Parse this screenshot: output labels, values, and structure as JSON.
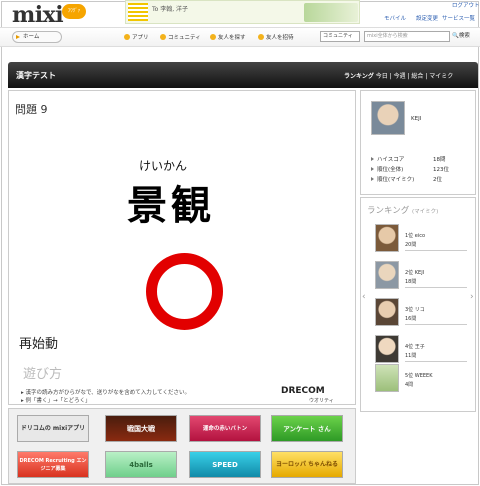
{
  "header": {
    "logo": "mixi",
    "logo_badge": "ﾌﾜｸﾞｧ",
    "banner_text": "To 李翰, 洋子",
    "top_links": {
      "logout": "ログアウト",
      "mobile": "モバイル",
      "settings": "設定変更",
      "service": "サービス一覧"
    },
    "nav": {
      "home": "ホーム",
      "app": "アプリ",
      "community": "コミュニティ",
      "find_friends": "友人を探す",
      "invite": "友人を招待"
    },
    "search": {
      "scope": "コミュニティ",
      "placeholder": "mixi全体から検索",
      "button": "検索"
    }
  },
  "titlebar": {
    "title": "漢字テスト",
    "ranking_label": "ランキング",
    "ranking_tabs": "今日 | 今週 | 総合 | マイミク"
  },
  "question": {
    "label": "問題 9",
    "reading": "けいかん",
    "kanji": "景観",
    "mark": "correct"
  },
  "restart": "再始動",
  "howto": "遊び方",
  "instructions": [
    "漢字の読み方がひらがなで、送りがなを含めて入力してください。",
    "例「書く」→「とどろく」"
  ],
  "sponsor": {
    "name": "DRECOM",
    "sub": "ウオリティ"
  },
  "profile": {
    "username": "KEJI",
    "stats": [
      {
        "label": "ハイスコア",
        "value": "18問"
      },
      {
        "label": "順位(全体)",
        "value": "123位"
      },
      {
        "label": "順位(マイミク)",
        "value": "2位"
      }
    ]
  },
  "ranking": {
    "title": "ランキング",
    "sub": "(マイミク)",
    "items": [
      {
        "pos": "1位 eico",
        "count": "20問"
      },
      {
        "pos": "2位 KEJI",
        "count": "18問"
      },
      {
        "pos": "3位 リコ",
        "count": "16問"
      },
      {
        "pos": "4位 王子",
        "count": "11問"
      },
      {
        "pos": "5位 WEEEK",
        "count": "4問"
      }
    ]
  },
  "apps": [
    {
      "label": "ドリコムの mixiアプリ"
    },
    {
      "label": "戦国大戦"
    },
    {
      "label": "運命の赤いバトン"
    },
    {
      "label": "アンケート さん"
    },
    {
      "label": "DRECOM Recruiting エンジニア募集"
    },
    {
      "label": "4balls"
    },
    {
      "label": "SPEED"
    },
    {
      "label": "ヨーロッパ ちゃんねる"
    }
  ],
  "colors": {
    "correct_mark": "#e20000",
    "titlebar": "#222222",
    "accent": "#f3b21b"
  }
}
